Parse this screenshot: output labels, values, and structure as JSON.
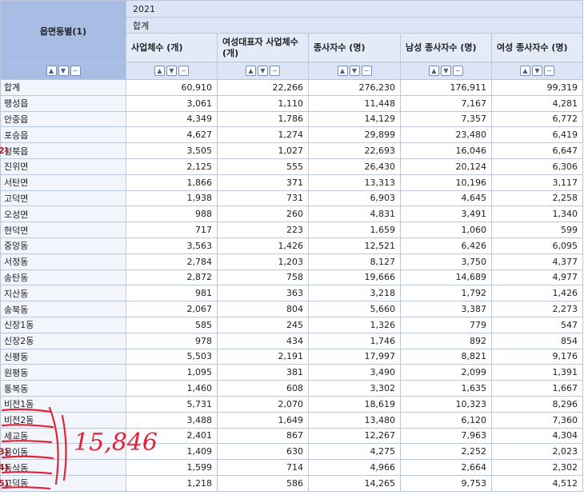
{
  "header": {
    "row_header_title": "읍면동별(1)",
    "year": "2021",
    "total_group": "합계",
    "columns": [
      "사업체수 (개)",
      "여성대표자 사업체수 (개)",
      "종사자수 (명)",
      "남성 종사자수 (명)",
      "여성 종사자수 (명)"
    ]
  },
  "controls": {
    "up_icon": "▲",
    "down_icon": "▼",
    "remove_icon": "−"
  },
  "rows": [
    {
      "label": "합계",
      "values": [
        "60,910",
        "22,266",
        "276,230",
        "176,911",
        "99,319"
      ]
    },
    {
      "label": "팽성읍",
      "values": [
        "3,061",
        "1,110",
        "11,448",
        "7,167",
        "4,281"
      ]
    },
    {
      "label": "안중읍",
      "values": [
        "4,349",
        "1,786",
        "14,129",
        "7,357",
        "6,772"
      ]
    },
    {
      "label": "포승읍",
      "values": [
        "4,627",
        "1,274",
        "29,899",
        "23,480",
        "6,419"
      ]
    },
    {
      "label": "청북읍",
      "values": [
        "3,505",
        "1,027",
        "22,693",
        "16,046",
        "6,647"
      ]
    },
    {
      "label": "진위면",
      "values": [
        "2,125",
        "555",
        "26,430",
        "20,124",
        "6,306"
      ]
    },
    {
      "label": "서탄면",
      "values": [
        "1,866",
        "371",
        "13,313",
        "10,196",
        "3,117"
      ]
    },
    {
      "label": "고덕면",
      "values": [
        "1,938",
        "731",
        "6,903",
        "4,645",
        "2,258"
      ]
    },
    {
      "label": "오성면",
      "values": [
        "988",
        "260",
        "4,831",
        "3,491",
        "1,340"
      ]
    },
    {
      "label": "현덕면",
      "values": [
        "717",
        "223",
        "1,659",
        "1,060",
        "599"
      ]
    },
    {
      "label": "중앙동",
      "values": [
        "3,563",
        "1,426",
        "12,521",
        "6,426",
        "6,095"
      ]
    },
    {
      "label": "서정동",
      "values": [
        "2,784",
        "1,203",
        "8,127",
        "3,750",
        "4,377"
      ]
    },
    {
      "label": "송탄동",
      "values": [
        "2,872",
        "758",
        "19,666",
        "14,689",
        "4,977"
      ]
    },
    {
      "label": "지산동",
      "values": [
        "981",
        "363",
        "3,218",
        "1,792",
        "1,426"
      ]
    },
    {
      "label": "송북동",
      "values": [
        "2,067",
        "804",
        "5,660",
        "3,387",
        "2,273"
      ]
    },
    {
      "label": "신장1동",
      "values": [
        "585",
        "245",
        "1,326",
        "779",
        "547"
      ]
    },
    {
      "label": "신장2동",
      "values": [
        "978",
        "434",
        "1,746",
        "892",
        "854"
      ]
    },
    {
      "label": "신평동",
      "values": [
        "5,503",
        "2,191",
        "17,997",
        "8,821",
        "9,176"
      ]
    },
    {
      "label": "원평동",
      "values": [
        "1,095",
        "381",
        "3,490",
        "2,099",
        "1,391"
      ]
    },
    {
      "label": "통복동",
      "values": [
        "1,460",
        "608",
        "3,302",
        "1,635",
        "1,667"
      ]
    },
    {
      "label": "비전1동",
      "values": [
        "5,731",
        "2,070",
        "18,619",
        "10,323",
        "8,296"
      ]
    },
    {
      "label": "비전2동",
      "values": [
        "3,488",
        "1,649",
        "13,480",
        "6,120",
        "7,360"
      ]
    },
    {
      "label": "세교동",
      "values": [
        "2,401",
        "867",
        "12,267",
        "7,963",
        "4,304"
      ]
    },
    {
      "label": "용이동",
      "values": [
        "1,409",
        "630",
        "4,275",
        "2,252",
        "2,023"
      ]
    },
    {
      "label": "동삭동",
      "values": [
        "1,599",
        "714",
        "4,966",
        "2,664",
        "2,302"
      ]
    },
    {
      "label": "고덕동",
      "values": [
        "1,218",
        "586",
        "14,265",
        "9,753",
        "4,512"
      ]
    }
  ],
  "annotations": {
    "handwritten_sum": "15,846",
    "margin_marks": [
      "2)",
      "3)",
      "4)",
      "5)"
    ],
    "ink_color": "#e0243a"
  }
}
